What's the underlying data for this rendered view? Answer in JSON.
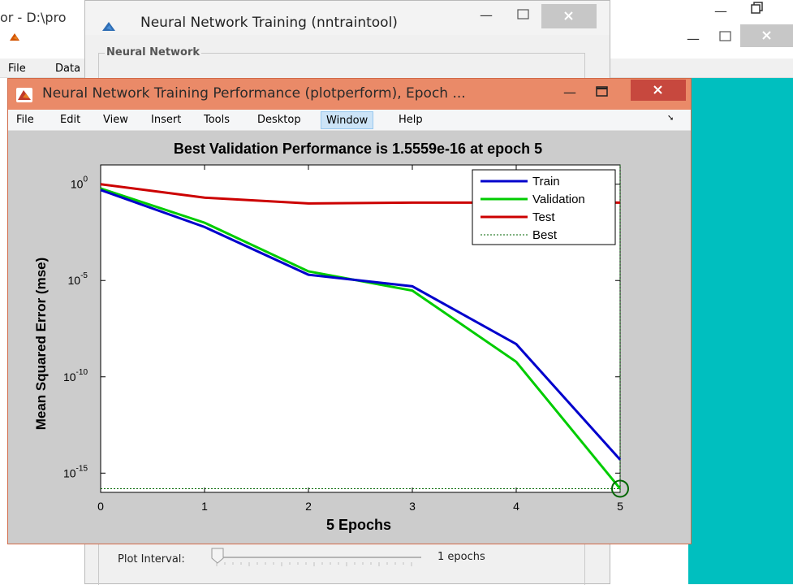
{
  "background_window": {
    "title": "or - D:\\pro",
    "menu": {
      "file": "File",
      "data": "Data"
    }
  },
  "nntraintool": {
    "title": "Neural Network Training (nntraintool)",
    "group_label": "Neural Network",
    "plot_interval_label": "Plot Interval:",
    "plot_interval_value": "1 epochs"
  },
  "perf_window": {
    "title": "Neural Network Training Performance (plotperform), Epoch ...",
    "menu": [
      "File",
      "Edit",
      "View",
      "Insert",
      "Tools",
      "Desktop",
      "Window",
      "Help"
    ],
    "active_menu": "Window"
  },
  "colors": {
    "teal_background": "#00bfbf",
    "perf_window_frame": "#ea8a68",
    "close_button": "#c7483e",
    "train": "#0000cc",
    "validation": "#00cc00",
    "test": "#cc0000",
    "best": "#006600"
  },
  "chart_data": {
    "type": "line",
    "title": "Best Validation Performance is 1.5559e-16 at epoch 5",
    "xlabel": "5 Epochs",
    "ylabel": "Mean Squared Error  (mse)",
    "y_scale": "log",
    "xlim": [
      0,
      5
    ],
    "ylim": [
      1e-16,
      10
    ],
    "x_ticks": [
      "0",
      "1",
      "2",
      "3",
      "4",
      "5"
    ],
    "y_ticks": [
      {
        "base": "10",
        "exp": "0",
        "value": 1
      },
      {
        "base": "10",
        "exp": "-5",
        "value": 1e-05
      },
      {
        "base": "10",
        "exp": "-10",
        "value": 1e-10
      },
      {
        "base": "10",
        "exp": "-15",
        "value": 1e-15
      }
    ],
    "x": [
      0,
      1,
      2,
      3,
      4,
      5
    ],
    "series": [
      {
        "name": "Train",
        "color": "#0000cc",
        "values": [
          0.5,
          0.006,
          2e-05,
          5e-06,
          5e-09,
          5e-15
        ]
      },
      {
        "name": "Validation",
        "color": "#00cc00",
        "values": [
          0.6,
          0.01,
          3e-05,
          3e-06,
          6e-10,
          1.5559e-16
        ]
      },
      {
        "name": "Test",
        "color": "#cc0000",
        "values": [
          1.0,
          0.2,
          0.1,
          0.11,
          0.11,
          0.11
        ]
      }
    ],
    "best": {
      "name": "Best",
      "epoch": 5,
      "value": 1.5559e-16,
      "color": "#006600"
    },
    "legend_position": "top-right",
    "grid": false
  }
}
